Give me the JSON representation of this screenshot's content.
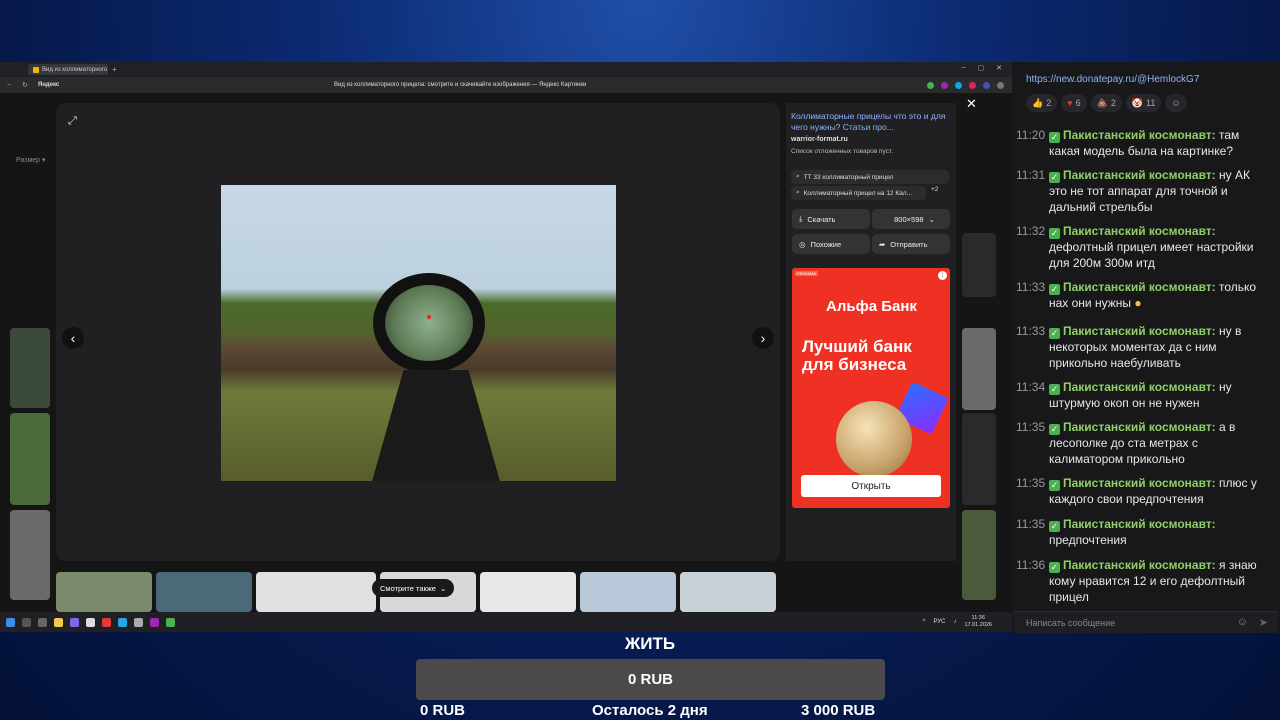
{
  "browser": {
    "tab_title": "Вид из коллиматорного",
    "site_name": "Яндекс",
    "url_title": "Вид из коллиматорного прицела: смотрите и скачивайте изображения — Яндекс Картинки"
  },
  "background_page": {
    "size_filter": "Размер ▾"
  },
  "viewer": {
    "source_title": "Коллиматорные прицелы что это и для чего нужны? Статьи про...",
    "source_site": "warrior-format.ru",
    "note": "Список отложенных товаров пуст.",
    "suggestions": [
      "ТТ 33 коллиматорный прицел",
      "Коллиматорный прицел на 12 Кал..."
    ],
    "more_count": "+2",
    "download_label": "Скачать",
    "resolution": "800×598",
    "similar_label": "Похожие",
    "share_label": "Отправить",
    "see_also": "Смотрите также"
  },
  "ad": {
    "label": "РЕКЛАМА",
    "brand": "Альфа Банк",
    "slogan": "Лучший банк для бизнеса",
    "button": "Открыть"
  },
  "taskbar": {
    "lang": "РУС",
    "time": "11:36",
    "date": "17.01.2026"
  },
  "chat": {
    "link": "https://new.donatepay.ru/@HemlockG7",
    "reactions": [
      {
        "icon": "👍",
        "count": "2"
      },
      {
        "icon": "♥",
        "count": "6"
      },
      {
        "icon": "💩",
        "count": "2"
      },
      {
        "icon": "🤡",
        "count": "11"
      }
    ],
    "messages": [
      {
        "time": "11:20",
        "user": "Пакистанский космонавт:",
        "text": " там какая модель была на картинке?"
      },
      {
        "time": "11:31",
        "user": "Пакистанский космонавт:",
        "text": " ну АК это не тот аппарат для точной и дальний стрельбы"
      },
      {
        "time": "11:32",
        "user": "Пакистанский космонавт:",
        "text": " дефолтный прицел имеет настройки для 200м 300м итд"
      },
      {
        "time": "11:33",
        "user": "Пакистанский космонавт:",
        "text": " только нах они нужны"
      },
      {
        "time": "11:33",
        "user": "Пакистанский космонавт:",
        "text": " ну в некоторых моментах да с ним прикольно наебуливать"
      },
      {
        "time": "11:34",
        "user": "Пакистанский космонавт:",
        "text": " ну штурмую окоп он не нужен"
      },
      {
        "time": "11:35",
        "user": "Пакистанский космонавт:",
        "text": " а в лесополке до ста метрах с калиматором прикольно"
      },
      {
        "time": "11:35",
        "user": "Пакистанский космонавт:",
        "text": " плюс у каждого свои предпочтения"
      },
      {
        "time": "11:35",
        "user": "Пакистанский космонавт:",
        "text": " предпочтения"
      },
      {
        "time": "11:36",
        "user": "Пакистанский космонавт:",
        "text": " я знаю кому нравится 12 и его дефолтный прицел"
      }
    ],
    "input_placeholder": "Написать сообщение"
  },
  "donation": {
    "title": "ЖИТЬ",
    "current": "0 RUB",
    "start": "0 RUB",
    "remaining": "Осталось 2 дня",
    "goal": "3 000 RUB",
    "progress": 0
  }
}
